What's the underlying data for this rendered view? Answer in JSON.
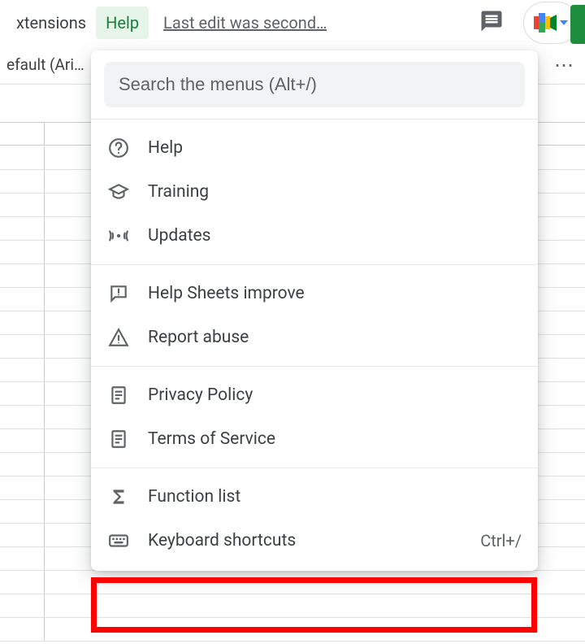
{
  "menubar": {
    "extensions": "xtensions",
    "help": "Help",
    "last_edit": "Last edit was second…"
  },
  "toolbar": {
    "font_name": "efault (Ari…",
    "more": "⋯"
  },
  "dropdown": {
    "search_placeholder": "Search the menus (Alt+/)",
    "items": [
      {
        "label": "Help",
        "icon": "question-circle-icon"
      },
      {
        "label": "Training",
        "icon": "graduation-cap-icon"
      },
      {
        "label": "Updates",
        "icon": "antenna-icon"
      }
    ],
    "items2": [
      {
        "label": "Help Sheets improve",
        "icon": "feedback-icon"
      },
      {
        "label": "Report abuse",
        "icon": "warning-icon"
      }
    ],
    "items3": [
      {
        "label": "Privacy Policy",
        "icon": "document-icon"
      },
      {
        "label": "Terms of Service",
        "icon": "document-icon"
      }
    ],
    "items4": [
      {
        "label": "Function list",
        "icon": "sigma-icon"
      },
      {
        "label": "Keyboard shortcuts",
        "icon": "keyboard-icon",
        "shortcut": "Ctrl+/"
      }
    ]
  }
}
